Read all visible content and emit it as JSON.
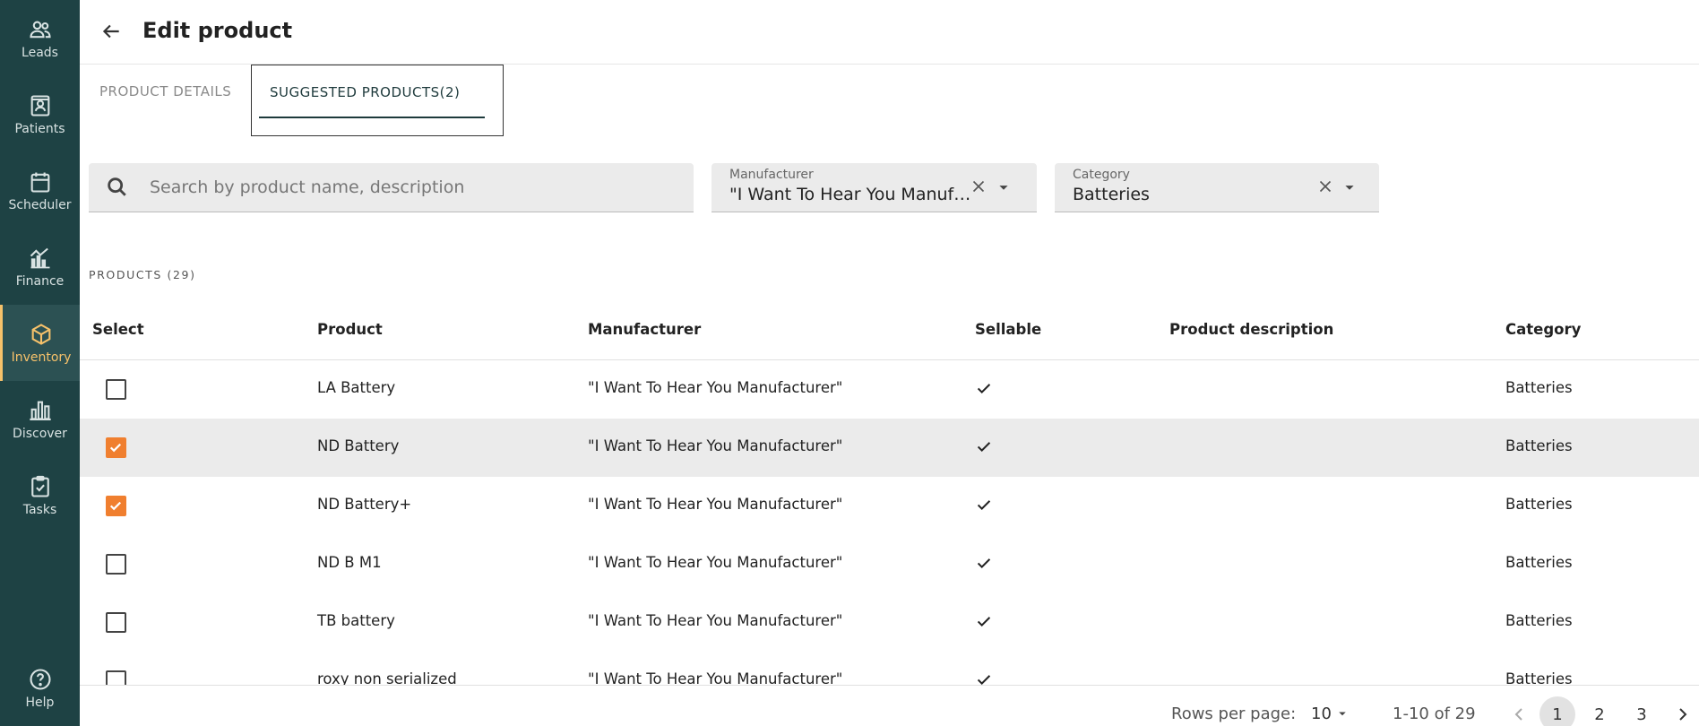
{
  "sidebar": {
    "items": [
      {
        "label": "Leads",
        "icon": "people-icon"
      },
      {
        "label": "Patients",
        "icon": "patient-card-icon"
      },
      {
        "label": "Scheduler",
        "icon": "calendar-icon"
      },
      {
        "label": "Finance",
        "icon": "finance-chart-icon"
      },
      {
        "label": "Inventory",
        "icon": "box-icon",
        "active": true
      },
      {
        "label": "Discover",
        "icon": "bar-chart-icon"
      },
      {
        "label": "Tasks",
        "icon": "clipboard-check-icon"
      }
    ],
    "help": "Help"
  },
  "header": {
    "title": "Edit product"
  },
  "tabs": [
    {
      "label": "PRODUCT DETAILS",
      "active": false
    },
    {
      "label": "SUGGESTED PRODUCTS(2)",
      "active": true
    }
  ],
  "filters": {
    "search_placeholder": "Search by product name, description",
    "manufacturer_label": "Manufacturer",
    "manufacturer_value": "\"I Want To Hear You Manufacturer\"",
    "category_label": "Category",
    "category_value": "Batteries"
  },
  "products_count": "PRODUCTS (29)",
  "table": {
    "headers": [
      "Select",
      "Product",
      "Manufacturer",
      "Sellable",
      "Product description",
      "Category"
    ],
    "rows": [
      {
        "checked": false,
        "product": "LA Battery",
        "manufacturer": "\"I Want To Hear You Manufacturer\"",
        "sellable": true,
        "description": "",
        "category": "Batteries"
      },
      {
        "checked": true,
        "product": "ND Battery",
        "manufacturer": "\"I Want To Hear You Manufacturer\"",
        "sellable": true,
        "description": "",
        "category": "Batteries"
      },
      {
        "checked": true,
        "product": "ND Battery+",
        "manufacturer": "\"I Want To Hear You Manufacturer\"",
        "sellable": true,
        "description": "",
        "category": "Batteries"
      },
      {
        "checked": false,
        "product": "ND B M1",
        "manufacturer": "\"I Want To Hear You Manufacturer\"",
        "sellable": true,
        "description": "",
        "category": "Batteries"
      },
      {
        "checked": false,
        "product": "TB battery",
        "manufacturer": "\"I Want To Hear You Manufacturer\"",
        "sellable": true,
        "description": "",
        "category": "Batteries"
      },
      {
        "checked": false,
        "product": "roxy non serialized",
        "manufacturer": "\"I Want To Hear You Manufacturer\"",
        "sellable": true,
        "description": "",
        "category": "Batteries"
      }
    ]
  },
  "pagination": {
    "rows_per_page_label": "Rows per page:",
    "rows_per_page_value": "10",
    "range": "1-10 of 29",
    "pages": [
      "1",
      "2",
      "3"
    ],
    "current_page": "1"
  },
  "colors": {
    "sidebar_bg": "#1e4244",
    "active_accent": "#f6c16a",
    "checkbox_checked": "#f07f2f"
  }
}
